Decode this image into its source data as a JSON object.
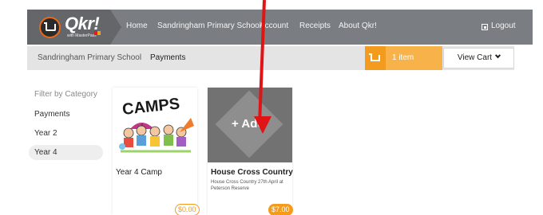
{
  "nav": {
    "logo_text": "Qkr!",
    "logo_tagline": "with MasterPass",
    "items": [
      "Home",
      "Sandringham Primary School",
      "Account",
      "Receipts",
      "About Qkr!"
    ],
    "logout": "Logout"
  },
  "breadcrumb": {
    "school": "Sandringham Primary School",
    "current": "Payments"
  },
  "cart": {
    "count": "1 item",
    "view_label": "View Cart"
  },
  "sidebar": {
    "title": "Filter by Category",
    "categories": [
      "Payments",
      "Year 2",
      "Year 4"
    ],
    "active": "Year 4"
  },
  "products": [
    {
      "title": "Year 4 Camp",
      "description": "",
      "image_text": "CAMPS",
      "price": "$0.00"
    },
    {
      "title": "House Cross Country",
      "description": "House Cross Country 27th April at Peterson Reserve",
      "overlay": "+ Add",
      "price": "$7.00"
    }
  ],
  "colors": {
    "nav_bg": "#7a7e82",
    "logo_bg": "#646669",
    "accent_orange": "#f39b1f",
    "annotation_red": "#e01414"
  }
}
